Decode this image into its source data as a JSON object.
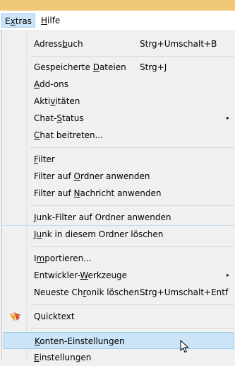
{
  "menubar": {
    "extras": {
      "pre": "E",
      "acc": "x",
      "post": "tras"
    },
    "hilfe": {
      "pre": "",
      "acc": "H",
      "post": "ilfe"
    }
  },
  "items": [
    {
      "pre": "Adress",
      "acc": "b",
      "post": "uch",
      "shortcut": "Strg+Umschalt+B"
    },
    {
      "pre": "Gespeicherte ",
      "acc": "D",
      "post": "ateien",
      "shortcut": "Strg+J"
    },
    {
      "pre": "",
      "acc": "A",
      "post": "dd-ons"
    },
    {
      "pre": "Akti",
      "acc": "v",
      "post": "itäten"
    },
    {
      "pre": "Chat-",
      "acc": "S",
      "post": "tatus"
    },
    {
      "pre": "",
      "acc": "C",
      "post": "hat beitreten..."
    },
    {
      "pre": "",
      "acc": "F",
      "post": "ilter"
    },
    {
      "pre": "Filter auf ",
      "acc": "O",
      "post": "rdner anwenden"
    },
    {
      "pre": "Filter auf ",
      "acc": "N",
      "post": "achricht anwenden"
    },
    {
      "pre": "",
      "acc": "J",
      "post": "unk-Filter auf Ordner anwenden"
    },
    {
      "pre": "J",
      "acc": "u",
      "post": "nk in diesem Ordner löschen"
    },
    {
      "pre": "I",
      "acc": "m",
      "post": "portieren..."
    },
    {
      "pre": "Entwickler-",
      "acc": "W",
      "post": "erkzeuge"
    },
    {
      "pre": "Neueste Ch",
      "acc": "r",
      "post": "onik löschen...",
      "shortcut": "Strg+Umschalt+Entf"
    },
    {
      "pre": "Quicktext",
      "acc": "",
      "post": ""
    },
    {
      "pre": "",
      "acc": "K",
      "post": "onten-Einstellungen"
    },
    {
      "pre": "",
      "acc": "E",
      "post": "instellungen"
    }
  ],
  "icons": {
    "submenu_arrow": "▸",
    "quicktext": "quicktext-icon",
    "cursor": "mouse-pointer-icon"
  },
  "colors": {
    "highlight": "#cce4f7",
    "highlight_border": "#99c9ef",
    "top_strip": "#f0c878"
  }
}
